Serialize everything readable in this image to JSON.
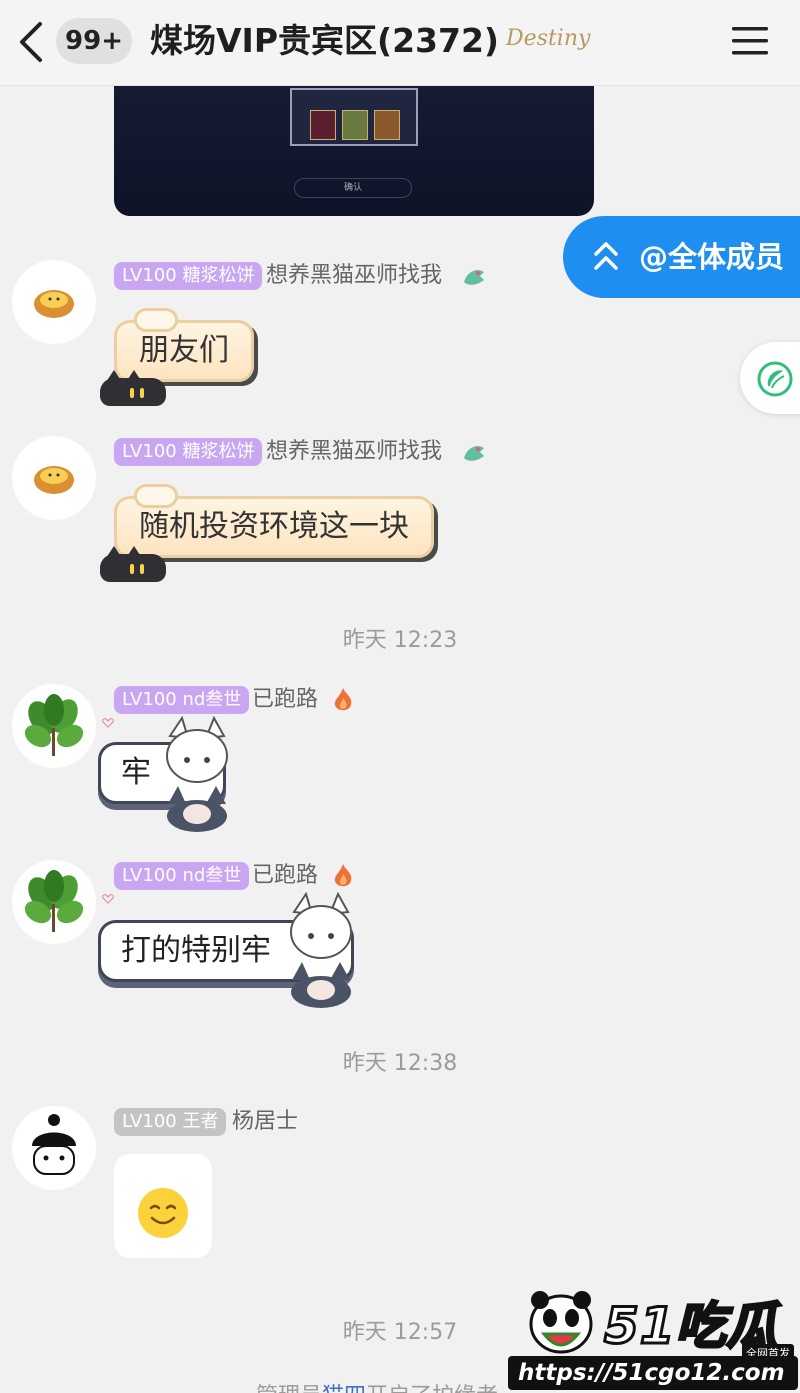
{
  "header": {
    "unread_badge": "99+",
    "group_title": "煤场VIP贵宾区(2372)",
    "title_decoration": "Destiny"
  },
  "image_message": {
    "dialog_button": "确认"
  },
  "at_all": {
    "label": "@全体成员"
  },
  "messages": [
    {
      "level": "LV100 糖浆松饼",
      "nickname": "想养黑猫巫师找我",
      "text": "朋友们"
    },
    {
      "level": "LV100 糖浆松饼",
      "nickname": "想养黑猫巫师找我",
      "text": "随机投资环境这一块"
    },
    {
      "timestamp": "昨天 12:23"
    },
    {
      "level": "LV100 nd叁世",
      "nickname": "已跑路",
      "text": "牢"
    },
    {
      "level": "LV100 nd叁世",
      "nickname": "已跑路",
      "text": "打的特别牢"
    },
    {
      "timestamp": "昨天 12:38"
    },
    {
      "level": "LV100 王者",
      "nickname": "杨居士",
      "sticker": "smile-emoji"
    },
    {
      "timestamp": "昨天 12:57"
    }
  ],
  "system_note": {
    "prefix": "管理员",
    "link": "猫四",
    "suffix": "开启了护缘者"
  },
  "watermark": {
    "logo": "51吃瓜",
    "tag": "全网首发",
    "url": "https://51cgo12.com"
  },
  "colors": {
    "accent_blue": "#1f8ef1",
    "level_purple": "#c8a6f2",
    "level_grey": "#c4c4c4",
    "background": "#f1f1f1"
  }
}
